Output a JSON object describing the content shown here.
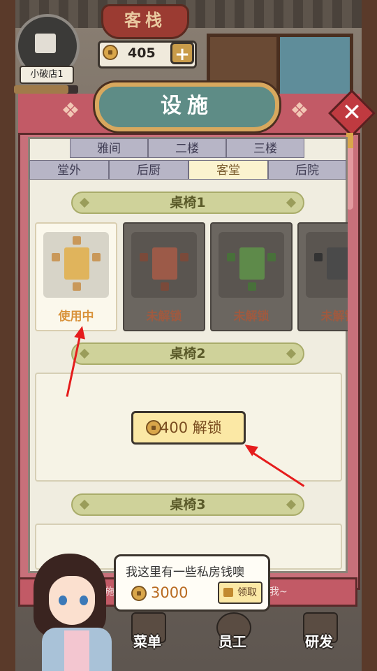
{
  "header": {
    "sign_text": "客栈",
    "shop_name": "小破店1",
    "coins": "405",
    "add_coins_label": "+",
    "exp_progress": 0.85
  },
  "panel": {
    "title": "设施",
    "close_label": "✕",
    "tabs_row1": [
      "雅间",
      "二楼",
      "三楼"
    ],
    "tabs_row2": [
      "堂外",
      "后厨",
      "客堂",
      "后院"
    ],
    "active_tab": "客堂"
  },
  "sections": [
    {
      "title": "桌椅1",
      "cards": [
        {
          "status": "使用中",
          "color": "#e0b45c"
        },
        {
          "status": "未解锁",
          "color": "#9c5a48"
        },
        {
          "status": "未解锁",
          "color": "#5e8a4a"
        },
        {
          "status": "未解锁",
          "color": "#4a4a4a"
        }
      ]
    },
    {
      "title": "桌椅2",
      "unlock_cost": "400",
      "unlock_label": "解锁"
    },
    {
      "title": "桌椅3"
    }
  ],
  "bottom_hint": {
    "left": "施",
    "right": "我~"
  },
  "speech": {
    "text": "我这里有一些私房钱噢",
    "reward": "3000",
    "claim_label": "领取"
  },
  "nav": [
    {
      "label": "菜单",
      "icon": "menu-book-icon"
    },
    {
      "label": "员工",
      "icon": "staff-icon"
    },
    {
      "label": "研发",
      "icon": "stove-icon"
    }
  ],
  "colors": {
    "accent_red": "#c25a66",
    "tab_active": "#fbf3cf",
    "arrow": "#e51c1c"
  }
}
